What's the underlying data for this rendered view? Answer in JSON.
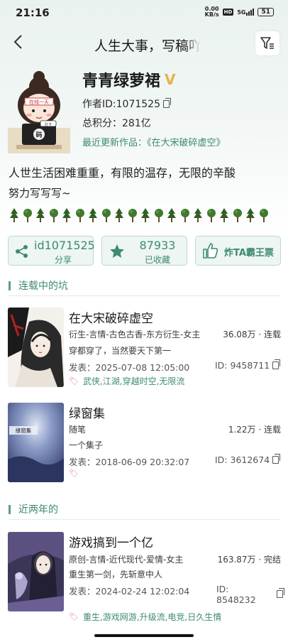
{
  "status_bar": {
    "time": "21:16",
    "speed_value": "0.00",
    "speed_unit": "KB/s",
    "hd": "HD",
    "network": "5G",
    "battery": "51"
  },
  "header": {
    "title": "人生大事，写稿吖"
  },
  "profile": {
    "pen_name": "青青绿萝裙",
    "vip_badge": "V",
    "author_id": "作者ID:1071525",
    "total_score": "总积分：281亿",
    "latest_work_label": "最近更新作品：《在大宋破碎虚空》",
    "bio_line1": "人世生活困难重重，有限的温存，无限的辛酸",
    "bio_line2": "努力写写写~",
    "tree_count": 20
  },
  "actions": {
    "share_value": "id1071525",
    "share_label": "分享",
    "favorite_value": "87933",
    "favorite_label": "已收藏",
    "vote_label": "炸TA霸王票"
  },
  "sections": {
    "ongoing": "连载中的坑",
    "recent": "近两年的"
  },
  "books": [
    {
      "title": "在大宋破碎虚空",
      "genre": "衍生-言情-古色古香-东方衍生-女主",
      "stats": "36.08万 · 连载",
      "summary": "穿都穿了，当然要天下第一",
      "date": "发表：2025-07-08 12:05:00",
      "id": "ID: 9458711",
      "tags": "武侠,江湖,穿越时空,无限流"
    },
    {
      "title": "绿窗集",
      "genre": "随笔",
      "stats": "1.22万 · 连载",
      "summary": "一个集子",
      "date": "发表：2018-06-09 20:32:07",
      "id": "ID: 3612674",
      "tags": "",
      "cover_text": "綠窗集"
    },
    {
      "title": "游戏搞到一个亿",
      "genre": "原创-言情-近代现代-爱情-女主",
      "stats": "163.87万 · 完结",
      "summary": "重生第一剑，先斩意中人",
      "date": "发表：2024-02-24 12:02:04",
      "id_line1": "ID:",
      "id_line2": "8548232",
      "tags": "重生,游戏网游,升级流,电竞,日久生情"
    }
  ],
  "avatar_text": {
    "sign": "在线一天",
    "screen": "打卡",
    "laptop": "码"
  },
  "colors": {
    "accent": "#3e8a73",
    "vip": "#e6b24a",
    "button_bg": "#edf6f2",
    "tag_icon": "#e08a95"
  }
}
